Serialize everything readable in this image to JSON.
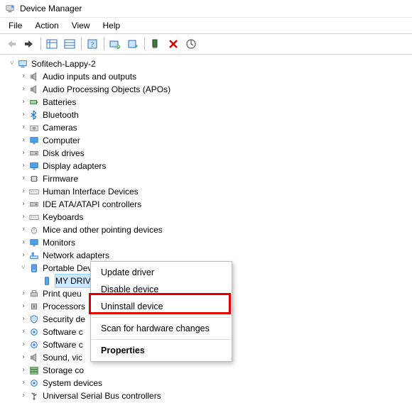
{
  "window": {
    "title": "Device Manager"
  },
  "menu": {
    "file": "File",
    "action": "Action",
    "view": "View",
    "help": "Help"
  },
  "tree": {
    "root": "Sofitech-Lappy-2",
    "nodes": [
      "Audio inputs and outputs",
      "Audio Processing Objects (APOs)",
      "Batteries",
      "Bluetooth",
      "Cameras",
      "Computer",
      "Disk drives",
      "Display adapters",
      "Firmware",
      "Human Interface Devices",
      "IDE ATA/ATAPI controllers",
      "Keyboards",
      "Mice and other pointing devices",
      "Monitors",
      "Network adapters",
      "Portable Devices",
      "Print queu",
      "Processors",
      "Security de",
      "Software c",
      "Software c",
      "Sound, vic",
      "Storage co",
      "System devices",
      "Universal Serial Bus controllers"
    ],
    "selected_child": "MY DRIVE"
  },
  "context_menu": {
    "update": "Update driver",
    "disable": "Disable device",
    "uninstall": "Uninstall device",
    "scan": "Scan for hardware changes",
    "properties": "Properties"
  }
}
